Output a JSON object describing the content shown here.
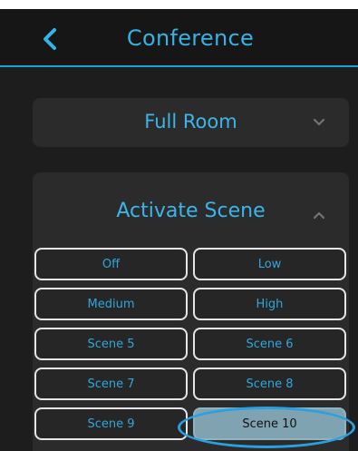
{
  "header": {
    "title": "Conference",
    "back_icon": "chevron-left-icon"
  },
  "room_selector": {
    "label": "Full Room",
    "icon": "chevron-down-icon"
  },
  "scene_panel": {
    "label": "Activate Scene",
    "icon": "chevron-up-icon",
    "buttons": [
      {
        "label": "Off",
        "active": false
      },
      {
        "label": "Low",
        "active": false
      },
      {
        "label": "Medium",
        "active": false
      },
      {
        "label": "High",
        "active": false
      },
      {
        "label": "Scene 5",
        "active": false
      },
      {
        "label": "Scene 6",
        "active": false
      },
      {
        "label": "Scene 7",
        "active": false
      },
      {
        "label": "Scene 8",
        "active": false
      },
      {
        "label": "Scene 9",
        "active": false
      },
      {
        "label": "Scene 10",
        "active": true
      }
    ]
  },
  "colors": {
    "accent": "#35b3e6",
    "background": "#1d1d1d",
    "card": "#2b2b2b",
    "active_button": "#7fa3b0",
    "highlight_ring": "#2aa0e0"
  }
}
